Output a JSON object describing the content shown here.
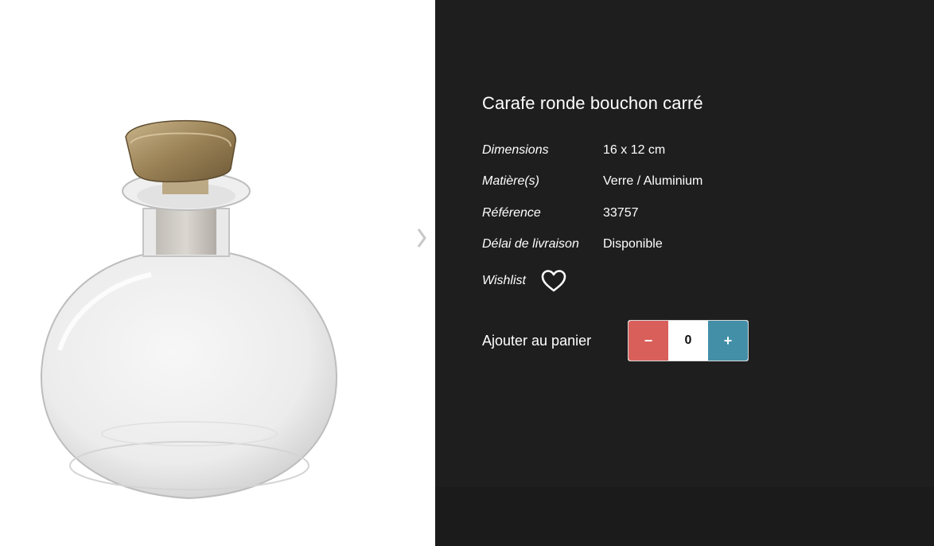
{
  "product": {
    "title": "Carafe ronde bouchon carré",
    "image_icon": "glass-carafe-image"
  },
  "specs": [
    {
      "label": "Dimensions",
      "value": "16 x 12 cm"
    },
    {
      "label": "Matière(s)",
      "value": "Verre / Aluminium"
    },
    {
      "label": "Référence",
      "value": "33757"
    },
    {
      "label": "Délai de livraison",
      "value": "Disponible"
    }
  ],
  "wishlist": {
    "label": "Wishlist",
    "icon": "heart-icon"
  },
  "cart": {
    "label": "Ajouter au panier",
    "minus_label": "−",
    "plus_label": "+",
    "quantity": "0"
  },
  "navigation": {
    "next_icon": "chevron-right-icon"
  },
  "colors": {
    "panel_background": "#1e1e1e",
    "minus_button": "#d9605a",
    "plus_button": "#438fa8",
    "text": "#ffffff"
  }
}
